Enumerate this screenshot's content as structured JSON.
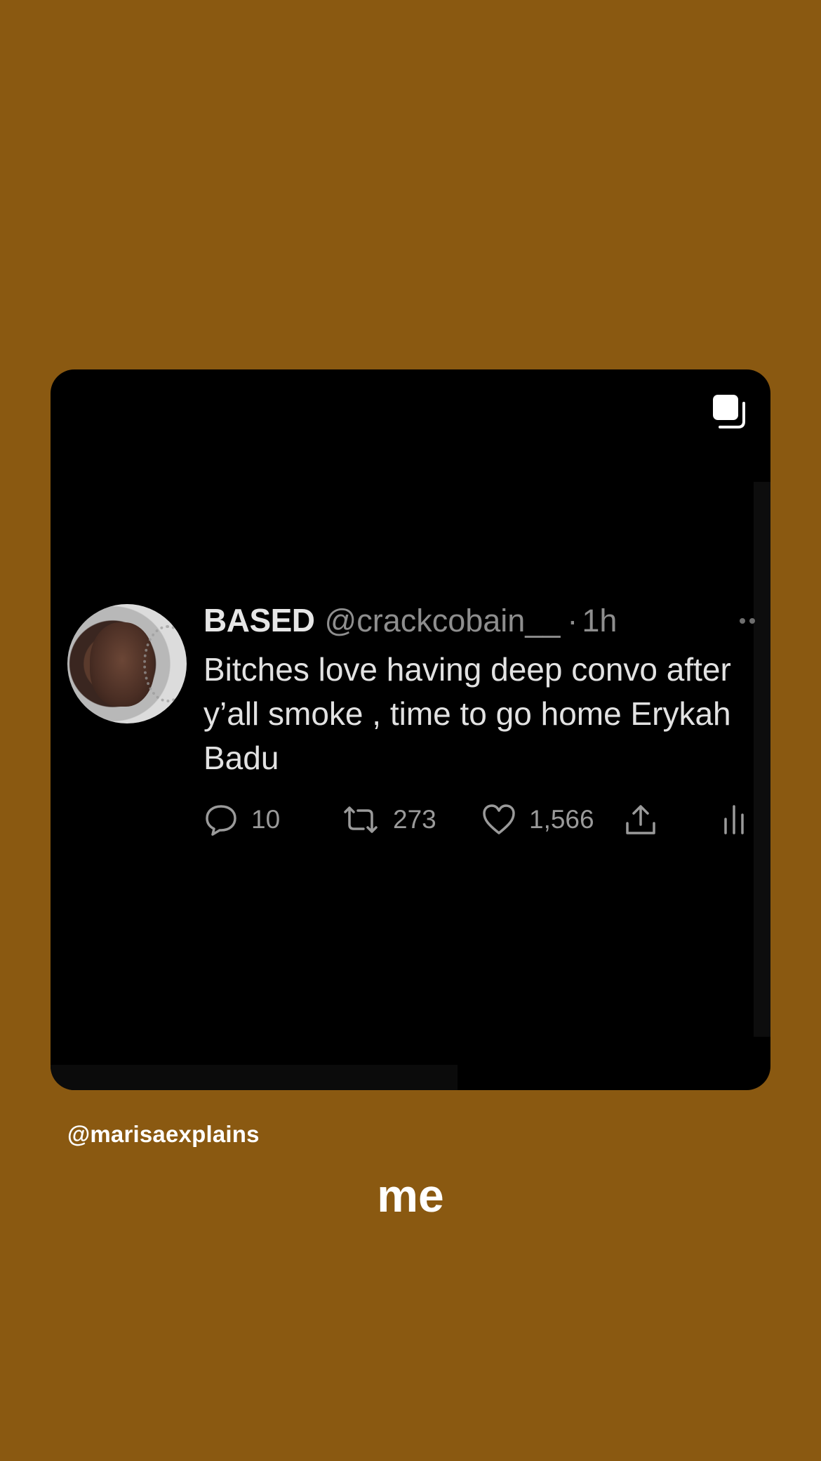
{
  "tweet": {
    "display_name": "BASED",
    "handle": "@crackcobain__",
    "separator": "·",
    "time": "1h",
    "text": "Bitches love having deep convo after y’all smoke , time to go home Erykah Badu",
    "actions": {
      "reply_icon": "reply-bubble-icon",
      "reply_count": "10",
      "retweet_icon": "retweet-arrows-icon",
      "retweet_count": "273",
      "like_icon": "heart-icon",
      "like_count": "1,566",
      "share_icon": "share-upload-icon",
      "analytics_icon": "analytics-bars-icon"
    }
  },
  "post": {
    "multi_icon": "multiple-posts-icon",
    "username_tag": "@marisaexplains",
    "caption": "me"
  },
  "colors": {
    "background": "#8a5911",
    "card": "#000000",
    "tweet_text": "#e2e2e2",
    "muted": "#8e8e8e"
  }
}
